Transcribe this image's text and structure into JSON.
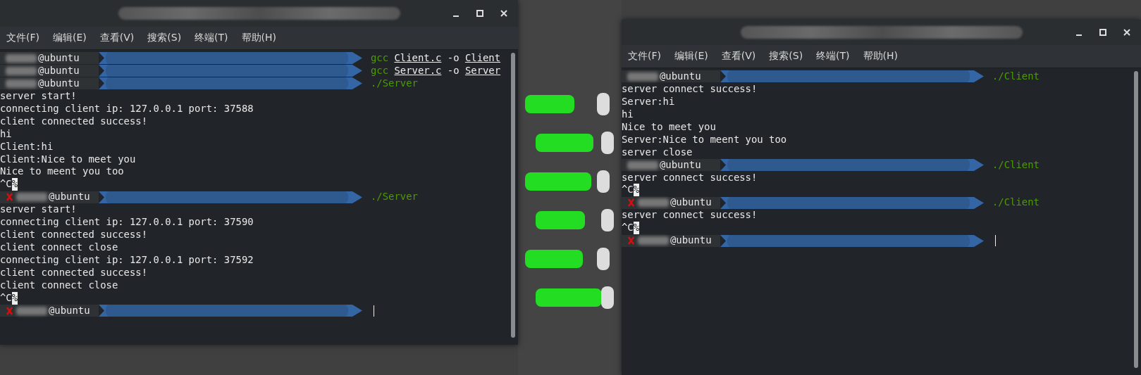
{
  "windows": [
    {
      "menu": [
        "文件(F)",
        "编辑(E)",
        "查看(V)",
        "搜索(S)",
        "终端(T)",
        "帮助(H)"
      ],
      "lines": [
        {
          "kind": "prompt",
          "failed": false,
          "user": "@ubuntu",
          "command": [
            {
              "kind": "program",
              "text": "gcc"
            },
            {
              "kind": "path",
              "text": "Client.c"
            },
            {
              "kind": "arg",
              "text": "-o"
            },
            {
              "kind": "path",
              "text": "Client"
            }
          ]
        },
        {
          "kind": "prompt",
          "failed": false,
          "user": "@ubuntu",
          "command": [
            {
              "kind": "program",
              "text": "gcc"
            },
            {
              "kind": "path",
              "text": "Server.c"
            },
            {
              "kind": "arg",
              "text": "-o"
            },
            {
              "kind": "path",
              "text": "Server"
            }
          ]
        },
        {
          "kind": "prompt",
          "failed": false,
          "user": "@ubuntu",
          "command": [
            {
              "kind": "program",
              "text": "./Server"
            }
          ]
        },
        {
          "kind": "output",
          "text": "server start!"
        },
        {
          "kind": "output",
          "text": "connecting client ip: 127.0.0.1 port: 37588"
        },
        {
          "kind": "output",
          "text": "client connected success!"
        },
        {
          "kind": "output",
          "text": "hi"
        },
        {
          "kind": "output",
          "text": "Client:hi"
        },
        {
          "kind": "output",
          "text": "Client:Nice to meet you"
        },
        {
          "kind": "output",
          "text": "Nice to meent you too"
        },
        {
          "kind": "interrupt",
          "text": "^C",
          "mark": "%"
        },
        {
          "kind": "prompt",
          "failed": true,
          "user": "@ubuntu",
          "command": [
            {
              "kind": "program",
              "text": "./Server"
            }
          ]
        },
        {
          "kind": "output",
          "text": "server start!"
        },
        {
          "kind": "output",
          "text": "connecting client ip: 127.0.0.1 port: 37590"
        },
        {
          "kind": "output",
          "text": "client connected success!"
        },
        {
          "kind": "output",
          "text": "client connect close"
        },
        {
          "kind": "output",
          "text": "connecting client ip: 127.0.0.1 port: 37592"
        },
        {
          "kind": "output",
          "text": "client connected success!"
        },
        {
          "kind": "output",
          "text": "client connect close"
        },
        {
          "kind": "interrupt",
          "text": "^C",
          "mark": "%"
        },
        {
          "kind": "prompt",
          "failed": true,
          "user": "@ubuntu",
          "cursor": true
        }
      ]
    },
    {
      "menu": [
        "文件(F)",
        "编辑(E)",
        "查看(V)",
        "搜索(S)",
        "终端(T)",
        "帮助(H)"
      ],
      "lines": [
        {
          "kind": "prompt",
          "failed": false,
          "user": "@ubuntu",
          "command": [
            {
              "kind": "program",
              "text": "./Client"
            }
          ]
        },
        {
          "kind": "output",
          "text": "server connect success!"
        },
        {
          "kind": "output",
          "text": "Server:hi"
        },
        {
          "kind": "output",
          "text": "hi"
        },
        {
          "kind": "output",
          "text": "Nice to meet you"
        },
        {
          "kind": "output",
          "text": "Server:Nice to meent you too"
        },
        {
          "kind": "output",
          "text": "server close"
        },
        {
          "kind": "prompt",
          "failed": false,
          "user": "@ubuntu",
          "command": [
            {
              "kind": "program",
              "text": "./Client"
            }
          ]
        },
        {
          "kind": "output",
          "text": "server connect success!"
        },
        {
          "kind": "interrupt",
          "text": "^C",
          "mark": "%"
        },
        {
          "kind": "prompt",
          "failed": true,
          "user": "@ubuntu",
          "command": [
            {
              "kind": "program",
              "text": "./Client"
            }
          ]
        },
        {
          "kind": "output",
          "text": "server connect success!"
        },
        {
          "kind": "interrupt",
          "text": "^C",
          "mark": "%"
        },
        {
          "kind": "prompt",
          "failed": true,
          "user": "@ubuntu",
          "cursor": true
        }
      ]
    }
  ]
}
